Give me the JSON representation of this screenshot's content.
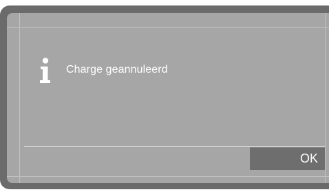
{
  "dialog": {
    "icon": "info-icon",
    "message": "Charge geannuleerd",
    "ok_label": "OK"
  },
  "colors": {
    "bezel": "#6b6b6b",
    "screen": "#a6a6a6",
    "button": "#6e6e6e",
    "text": "#ffffff"
  }
}
